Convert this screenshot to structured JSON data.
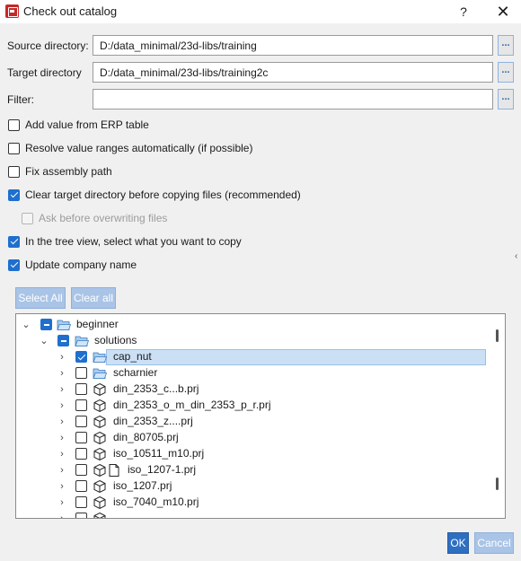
{
  "window": {
    "title": "Check out catalog",
    "help": "?",
    "close": "✕"
  },
  "fields": [
    {
      "label": "Source directory:",
      "value": "D:/data_minimal/23d-libs/training",
      "browse": "..."
    },
    {
      "label": "Target directory",
      "value": "D:/data_minimal/23d-libs/training2c",
      "browse": "..."
    },
    {
      "label": "Filter:",
      "value": "",
      "browse": "..."
    }
  ],
  "options": [
    {
      "label": "Add value from ERP table",
      "checked": false
    },
    {
      "label": "Resolve value ranges automatically (if possible)",
      "checked": false
    },
    {
      "label": "Fix assembly path",
      "checked": false
    },
    {
      "label": "Clear target directory before copying files (recommended)",
      "checked": true
    },
    {
      "label": "Ask before overwriting files",
      "checked": false,
      "disabled": true
    },
    {
      "label": "In the tree view, select what you want to copy",
      "checked": true
    },
    {
      "label": "Update company name",
      "checked": true
    }
  ],
  "tree_buttons": {
    "select_all": "Select All",
    "clear_all": "Clear all"
  },
  "tree": [
    {
      "label": "beginner",
      "level": 0,
      "state": "partial",
      "icon": "folder-open-icon",
      "expanded": true
    },
    {
      "label": "solutions",
      "level": 1,
      "state": "partial",
      "icon": "folder-open-icon",
      "expanded": true
    },
    {
      "label": "cap_nut",
      "level": 2,
      "state": "checked",
      "icon": "folder-open-icon",
      "selected": true
    },
    {
      "label": "scharnier",
      "level": 2,
      "state": "unchecked",
      "icon": "folder-open-icon"
    },
    {
      "label": "din_2353_c...b.prj",
      "level": 2,
      "state": "unchecked",
      "icon": "cube-icon"
    },
    {
      "label": "din_2353_o_m_din_2353_p_r.prj",
      "level": 2,
      "state": "unchecked",
      "icon": "cube-icon"
    },
    {
      "label": "din_2353_z....prj",
      "level": 2,
      "state": "unchecked",
      "icon": "cube-icon"
    },
    {
      "label": "din_80705.prj",
      "level": 2,
      "state": "unchecked",
      "icon": "cube-icon"
    },
    {
      "label": "iso_10511_m10.prj",
      "level": 2,
      "state": "unchecked",
      "icon": "cube-icon"
    },
    {
      "label": "iso_1207-1.prj",
      "level": 2,
      "state": "unchecked",
      "icon": "cube-document-icon"
    },
    {
      "label": "iso_1207.prj",
      "level": 2,
      "state": "unchecked",
      "icon": "cube-icon"
    },
    {
      "label": "iso_7040_m10.prj",
      "level": 2,
      "state": "unchecked",
      "icon": "cube-icon"
    }
  ],
  "buttons": {
    "ok": "OK",
    "cancel": "Cancel"
  }
}
